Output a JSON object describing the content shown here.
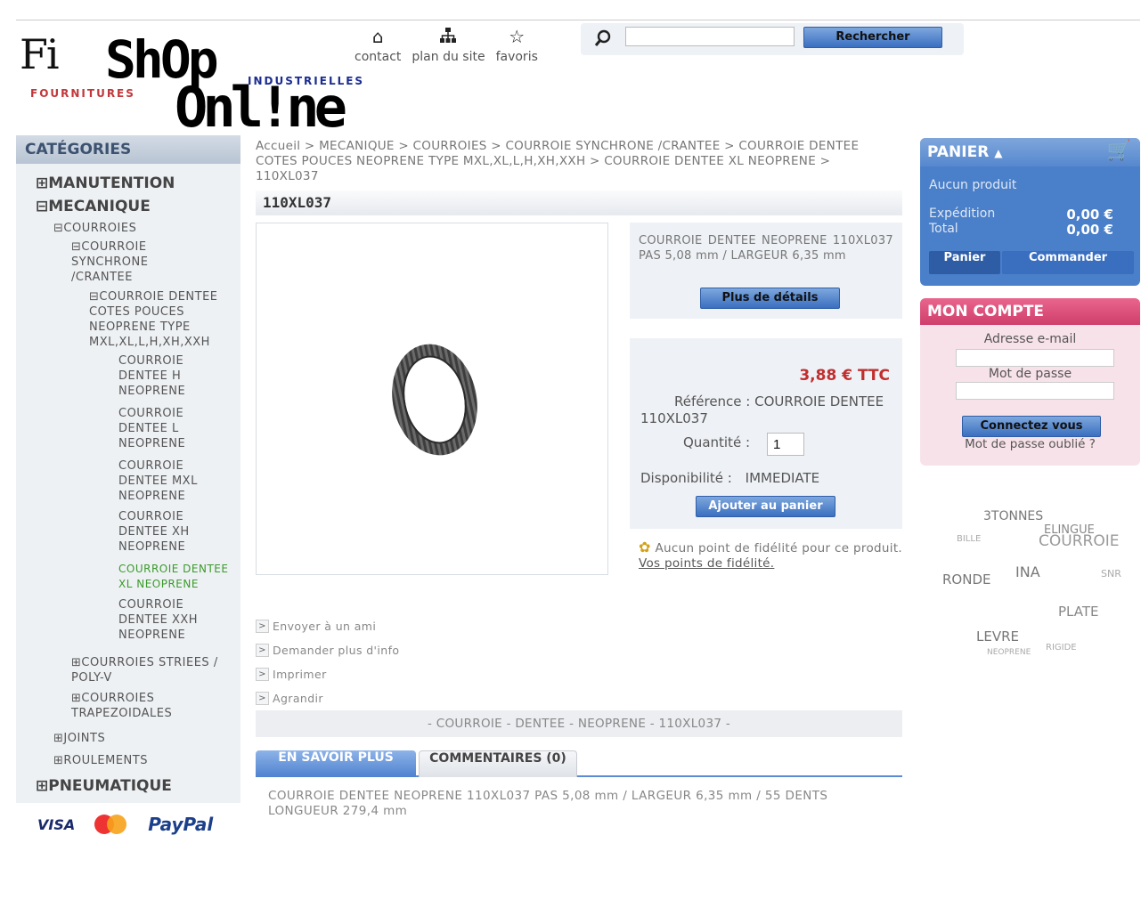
{
  "logo": {
    "fi": "Fi",
    "shop": "ShOp",
    "online": "Onl!ne",
    "fournitures": "FOURNITURES",
    "industrielles": "INDUSTRIELLES"
  },
  "header": {
    "links": [
      {
        "icon": "home-icon",
        "label": "contact"
      },
      {
        "icon": "sitemap-icon",
        "label": "plan du site"
      },
      {
        "icon": "star-icon",
        "label": "favoris"
      }
    ],
    "search": {
      "value": "",
      "placeholder": "",
      "button": "Rechercher"
    }
  },
  "left": {
    "title": "CATÉGORIES",
    "categories": [
      {
        "label": "⊞MANUTENTION"
      },
      {
        "label": "⊟MECANIQUE"
      },
      {
        "label": "⊟COURROIES"
      },
      {
        "label": "⊟COURROIE SYNCHRONE /CRANTEE"
      },
      {
        "label": "⊟COURROIE DENTEE COTES POUCES NEOPRENE TYPE MXL,XL,L,H,XH,XXH"
      },
      {
        "label": "COURROIE DENTEE H NEOPRENE"
      },
      {
        "label": "COURROIE DENTEE L NEOPRENE"
      },
      {
        "label": "COURROIE DENTEE MXL NEOPRENE"
      },
      {
        "label": "COURROIE DENTEE XH NEOPRENE"
      },
      {
        "label": "COURROIE DENTEE XL NEOPRENE"
      },
      {
        "label": "COURROIE DENTEE XXH NEOPRENE"
      },
      {
        "label": "⊞COURROIES STRIEES / POLY-V"
      },
      {
        "label": "⊞COURROIES TRAPEZOIDALES"
      },
      {
        "label": "⊞JOINTS"
      },
      {
        "label": "⊞ROULEMENTS"
      },
      {
        "label": "⊞PNEUMATIQUE"
      }
    ],
    "payments": [
      "VISA",
      "PayPal"
    ]
  },
  "breadcrumb": "Accueil > MECANIQUE > COURROIES > COURROIE SYNCHRONE /CRANTEE > COURROIE DENTEE COTES POUCES NEOPRENE TYPE MXL,XL,L,H,XH,XXH > COURROIE DENTEE XL NEOPRENE > 110XL037",
  "product": {
    "title": "110XL037",
    "short_desc": "COURROIE DENTEE NEOPRENE 110XL037 PAS 5,08 mm / LARGEUR 6,35 mm",
    "detail_button": "Plus de détails",
    "price": "3,88 € TTC",
    "reference_label": "Référence :",
    "reference": "COURROIE DENTEE 110XL037",
    "quantity_label": "Quantité :",
    "quantity": "1",
    "dispo_label": "Disponibilité :",
    "dispo": "IMMEDIATE",
    "cart_button": "Ajouter au panier",
    "fidelity_text": "Aucun point de fidélité pour ce produit.",
    "fidelity_link": "Vos points de fidélité.",
    "actions": [
      "Envoyer à un ami",
      "Demander plus d'info",
      "Imprimer",
      "Agrandir"
    ],
    "tags": "- COURROIE - DENTEE - NEOPRENE - 110XL037 -",
    "tabs": [
      "EN SAVOIR PLUS",
      "COMMENTAIRES (0)"
    ],
    "long_desc": "COURROIE DENTEE NEOPRENE 110XL037 PAS 5,08 mm / LARGEUR 6,35 mm / 55 DENTS LONGUEUR 279,4 mm"
  },
  "cart": {
    "title": "PANIER",
    "empty": "Aucun produit",
    "shipping_label": "Expédition",
    "shipping": "0,00 €",
    "total_label": "Total",
    "total": "0,00 €",
    "btn_cart": "Panier",
    "btn_order": "Commander"
  },
  "account": {
    "title": "MON COMPTE",
    "email_label": "Adresse e-mail",
    "password_label": "Mot de passe",
    "login_button": "Connectez vous",
    "forgot": "Mot de passe oublié ?"
  },
  "tag_cloud": [
    "3TONNES",
    "ELINGUE",
    "COURROIE",
    "BILLE",
    "RONDE",
    "INA",
    "SNR",
    "PLATE",
    "LEVRE",
    "RIGIDE",
    "NEOPRENE"
  ],
  "colors": {
    "accent_blue": "#4a7fc9",
    "account_pink": "#cf3e6c",
    "price_red": "#c22e2e",
    "current_green": "#3a9a2a"
  }
}
